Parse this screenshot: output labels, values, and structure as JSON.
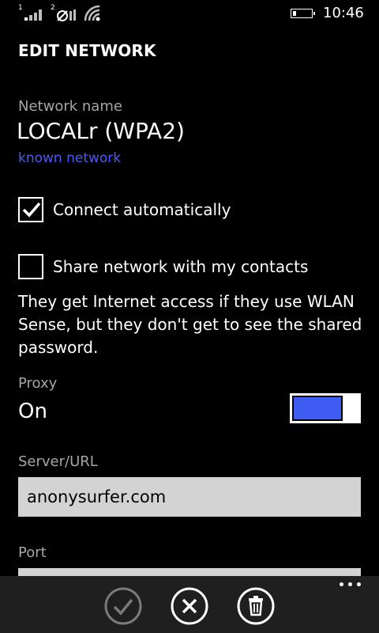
{
  "status_bar": {
    "sim1_label": "1",
    "sim2_label": "2",
    "time": "10:46"
  },
  "page": {
    "title": "EDIT NETWORK"
  },
  "network": {
    "name_label": "Network name",
    "name": "LOCALr (WPA2)",
    "status_link": "known network"
  },
  "options": {
    "connect_automatically": {
      "label": "Connect automatically",
      "checked": true
    },
    "share_network": {
      "label": "Share network with my contacts",
      "checked": false
    },
    "share_description": "They get Internet access if they use WLAN Sense, but they don't get to see the shared password."
  },
  "proxy": {
    "label": "Proxy",
    "state_text": "On",
    "enabled": true
  },
  "server": {
    "label": "Server/URL",
    "value": "anonysurfer.com"
  },
  "port": {
    "label": "Port",
    "value": ""
  },
  "app_bar": {
    "icons": [
      "check-icon",
      "close-icon",
      "delete-icon",
      "more-icon"
    ]
  },
  "colors": {
    "background": "#000000",
    "accent": "#3e5cf2",
    "link": "#4a5bf0",
    "label_gray": "#a5a5a5",
    "textbox": "#d3d3d3",
    "app_bar": "#1f1f1f"
  }
}
